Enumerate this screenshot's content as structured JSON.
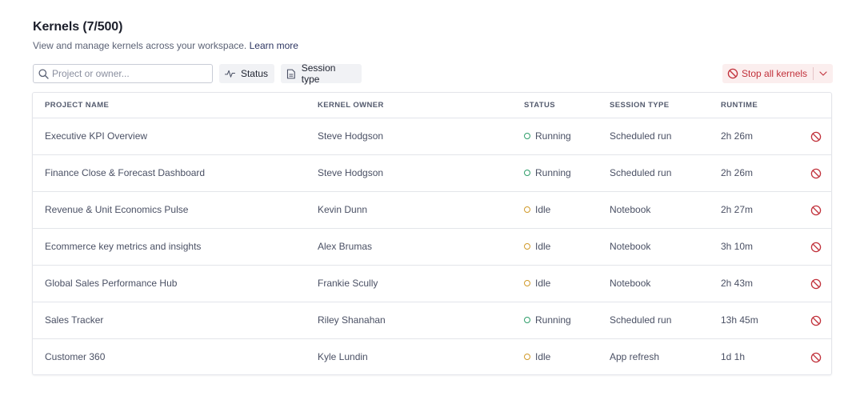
{
  "header": {
    "title": "Kernels (7/500)",
    "subtitle": "View and manage kernels across your workspace.",
    "learn_more": "Learn more"
  },
  "toolbar": {
    "search_placeholder": "Project or owner...",
    "search_value": "",
    "status_filter_label": "Status",
    "session_type_filter_label": "Session type",
    "stop_all_label": "Stop all kernels"
  },
  "colors": {
    "running": "#2f9e6a",
    "idle": "#d19a2a",
    "danger": "#c1303a"
  },
  "icons": {
    "search": "search-icon",
    "status": "activity-icon",
    "session_type": "document-icon",
    "stop": "stop-icon",
    "caret": "chevron-down-icon"
  },
  "table": {
    "columns": [
      "Project name",
      "Kernel owner",
      "Status",
      "Session type",
      "Runtime"
    ],
    "rows": [
      {
        "project": "Executive KPI Overview",
        "owner": "Steve Hodgson",
        "status": "Running",
        "session_type": "Scheduled run",
        "runtime": "2h 26m"
      },
      {
        "project": "Finance Close & Forecast Dashboard",
        "owner": "Steve Hodgson",
        "status": "Running",
        "session_type": "Scheduled run",
        "runtime": "2h 26m"
      },
      {
        "project": "Revenue & Unit Economics Pulse",
        "owner": "Kevin Dunn",
        "status": "Idle",
        "session_type": "Notebook",
        "runtime": "2h 27m"
      },
      {
        "project": "Ecommerce key metrics and insights",
        "owner": "Alex Brumas",
        "status": "Idle",
        "session_type": "Notebook",
        "runtime": "3h 10m"
      },
      {
        "project": "Global Sales Performance Hub",
        "owner": "Frankie Scully",
        "status": "Idle",
        "session_type": "Notebook",
        "runtime": "2h 43m"
      },
      {
        "project": "Sales Tracker",
        "owner": "Riley Shanahan",
        "status": "Running",
        "session_type": "Scheduled run",
        "runtime": "13h 45m"
      },
      {
        "project": "Customer 360",
        "owner": "Kyle Lundin",
        "status": "Idle",
        "session_type": "App refresh",
        "runtime": "1d 1h"
      }
    ]
  }
}
